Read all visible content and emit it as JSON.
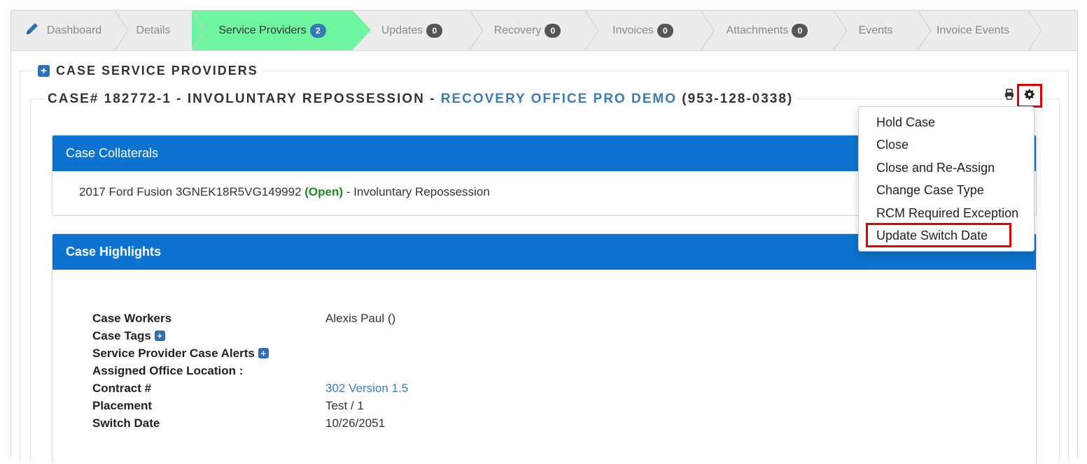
{
  "tabs": [
    {
      "label": "Dashboard",
      "badge": null
    },
    {
      "label": "Details",
      "badge": null
    },
    {
      "label": "Service Providers",
      "badge": "2"
    },
    {
      "label": "Updates",
      "badge": "0"
    },
    {
      "label": "Recovery",
      "badge": "0"
    },
    {
      "label": "Invoices",
      "badge": "0"
    },
    {
      "label": "Attachments",
      "badge": "0"
    },
    {
      "label": "Events",
      "badge": null
    },
    {
      "label": "Invoice Events",
      "badge": null
    }
  ],
  "section": {
    "title": "CASE SERVICE PROVIDERS"
  },
  "case_header": {
    "prefix": "CASE# 182772-1 - INVOLUNTARY REPOSSESSION - ",
    "company_link": "RECOVERY OFFICE PRO DEMO",
    "phone": " (953-128-0338)"
  },
  "collaterals": {
    "title": "Case Collaterals",
    "item_text": "2017 Ford Fusion 3GNEK18R5VG149992 ",
    "status": "(Open)",
    "suffix": " - Involuntary Repossession"
  },
  "highlights": {
    "title": "Case Highlights",
    "rows": [
      {
        "label": "Case Workers",
        "value": "Alexis Paul ()"
      },
      {
        "label": "Case Tags",
        "value": ""
      },
      {
        "label": "Service Provider Case Alerts",
        "value": ""
      },
      {
        "label": "Assigned Office Location :",
        "value": ""
      },
      {
        "label": "Contract #",
        "value": "302 Version 1.5"
      },
      {
        "label": "Placement",
        "value": "Test / 1"
      },
      {
        "label": "Switch Date",
        "value": "10/26/2051"
      }
    ]
  },
  "dropdown": {
    "items": [
      "Hold Case",
      "Close",
      "Close and Re-Assign",
      "Change Case Type",
      "RCM Required Exception",
      "Update Switch Date"
    ]
  },
  "colors": {
    "active_tab": "#6ff59f",
    "panel_header": "#0c74d0",
    "link": "#3a7bb8",
    "highlight": "#e00000"
  },
  "icons": [
    "pencil-icon",
    "plus-icon",
    "print-icon",
    "gear-icon"
  ]
}
